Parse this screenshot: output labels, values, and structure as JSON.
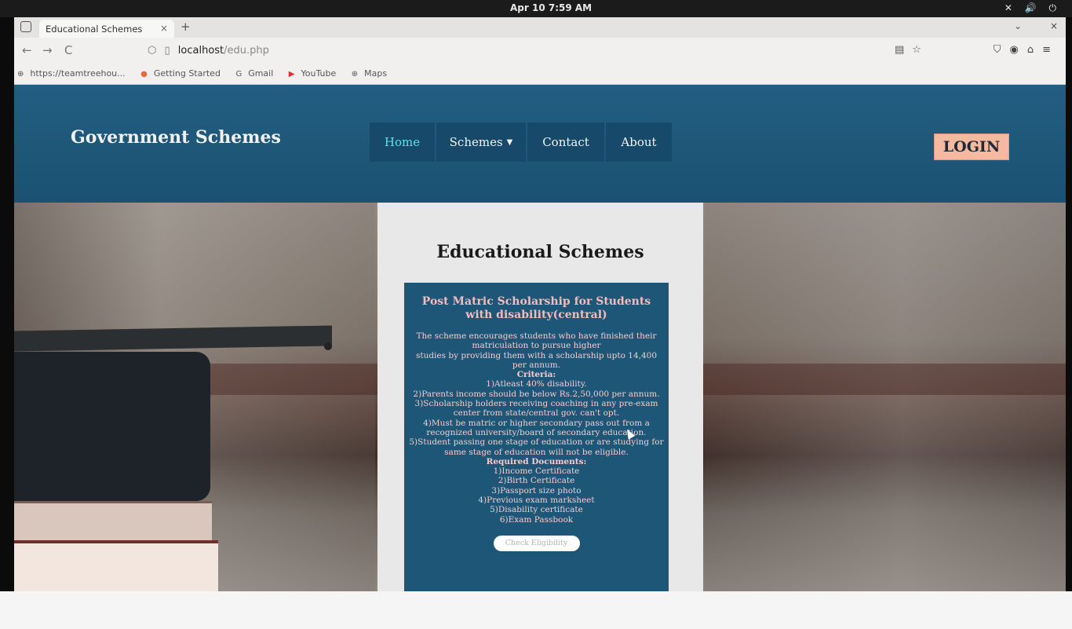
{
  "os": {
    "clock": "Apr 10  7:59 AM",
    "status_icons": "✕ 🔊 ⏻"
  },
  "browser": {
    "tab_title": "Educational Schemes",
    "tab_close": "×",
    "new_tab": "+",
    "tab_dropdown": "⌄",
    "window_close": "×",
    "back": "←",
    "forward": "→",
    "reload": "C",
    "url_host": "localhost",
    "url_path": "/edu.php",
    "bookmarks": [
      {
        "label": "https://teamtreehou...",
        "icon": "globe-icon"
      },
      {
        "label": "Getting Started",
        "icon": "firefox-icon"
      },
      {
        "label": "Gmail",
        "icon": "google-icon"
      },
      {
        "label": "YouTube",
        "icon": "youtube-icon"
      },
      {
        "label": "Maps",
        "icon": "globe-icon"
      }
    ]
  },
  "site": {
    "brand": "Government Schemes",
    "nav": {
      "home": "Home",
      "schemes": "Schemes",
      "contact": "Contact",
      "about": "About"
    },
    "login": "LOGIN"
  },
  "main": {
    "title": "Educational Schemes",
    "card": {
      "title": "Post Matric Scholarship for Students with disability(central)",
      "lines": [
        "The scheme encourages students who have finished their matriculation to pursue higher",
        "studies by providing them with a scholarship upto 14,400 per annum.",
        "Criteria:",
        "1)Atleast 40% disability.",
        "2)Parents income should be below Rs.2,50,000 per annum.",
        "3)Scholarship holders receiving coaching in any pre-exam center from state/central gov. can't opt.",
        "4)Must be matric or higher secondary pass out from a recognized university/board of secondary education.",
        "5)Student passing one stage of education or are studying for same stage of education will not be eligible.",
        "Required Documents:",
        "1)Income Certificate",
        "2)Birth Certificate",
        "3)Passport size photo",
        "4)Previous exam marksheet",
        "5)Disability certificate",
        "6)Exam Passbook"
      ],
      "button": "Check Eligibility"
    }
  },
  "colors": {
    "header_bg": "#1d5677",
    "nav_bg": "#17496a",
    "nav_active": "#5fe0e8",
    "login_bg": "#f4b9a0",
    "card_bg": "#1d5677",
    "card_text": "#f4c3c3"
  }
}
